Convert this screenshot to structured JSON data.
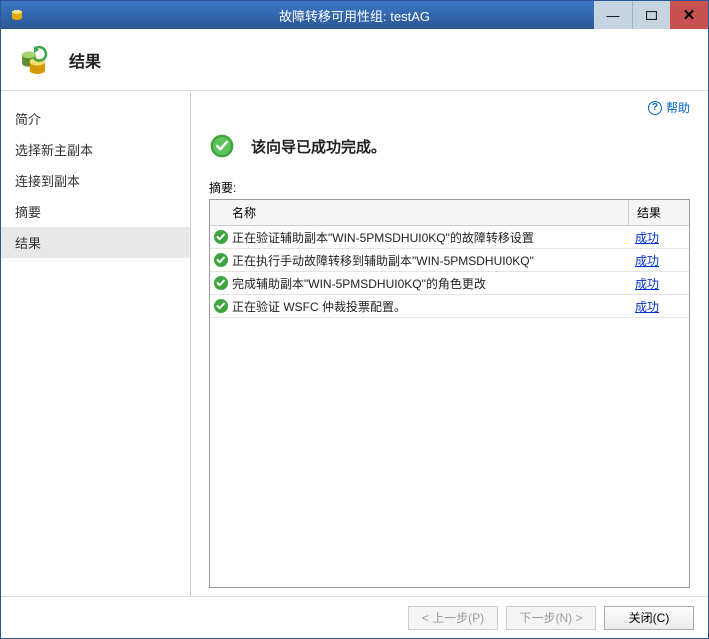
{
  "titlebar": {
    "title": "故障转移可用性组: testAG"
  },
  "header": {
    "page_title": "结果"
  },
  "sidebar": {
    "items": [
      {
        "label": "简介"
      },
      {
        "label": "选择新主副本"
      },
      {
        "label": "连接到副本"
      },
      {
        "label": "摘要"
      },
      {
        "label": "结果"
      }
    ]
  },
  "content": {
    "help_label": "帮助",
    "status_message": "该向导已成功完成。",
    "summary_label": "摘要:",
    "columns": {
      "name": "名称",
      "result": "结果"
    },
    "rows": [
      {
        "name": "正在验证辅助副本\"WIN-5PMSDHUI0KQ\"的故障转移设置",
        "result": "成功"
      },
      {
        "name": "正在执行手动故障转移到辅助副本\"WIN-5PMSDHUI0KQ\"",
        "result": "成功"
      },
      {
        "name": "完成辅助副本\"WIN-5PMSDHUI0KQ\"的角色更改",
        "result": "成功"
      },
      {
        "name": "正在验证 WSFC 仲裁投票配置。",
        "result": "成功"
      }
    ]
  },
  "footer": {
    "prev": "< 上一步(P)",
    "next": "下一步(N) >",
    "close": "关闭(C)"
  }
}
